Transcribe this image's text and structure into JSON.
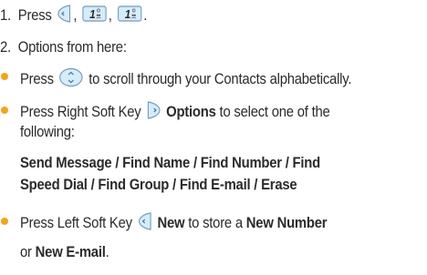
{
  "steps": [
    {
      "number": "1.",
      "text_before": "Press",
      "sep1": ",",
      "sep2": ",",
      "end": "."
    },
    {
      "number": "2.",
      "text": "Options from here:"
    }
  ],
  "bullets": {
    "scroll": {
      "before": "Press",
      "after": "to scroll through your Contacts alphabetically."
    },
    "options": {
      "before": "Press Right Soft Key",
      "label": "Options",
      "after": "to select one of the",
      "line2": "following:",
      "list_line1": "Send Message / Find Name / Find Number / Find",
      "list_line2": "Speed Dial / Find Group / Find E-mail / Erase"
    },
    "new": {
      "before": "Press Left Soft Key",
      "label": "New",
      "middle": "to store a",
      "number_label": "New Number",
      "line2_before": "or",
      "email_label": "New E-mail",
      "line2_after": "."
    }
  },
  "icons": {
    "left_soft_key": "left-soft-key-icon",
    "right_soft_key": "right-soft-key-icon",
    "nav_key": "navigation-key-icon",
    "key_1": "key-1-icon",
    "key_1_label": "1"
  },
  "colors": {
    "bullet": "#f2a51c",
    "text": "#2b2b2b",
    "icon_fill": "#d6ecfa",
    "icon_stroke": "#6f9cba"
  }
}
